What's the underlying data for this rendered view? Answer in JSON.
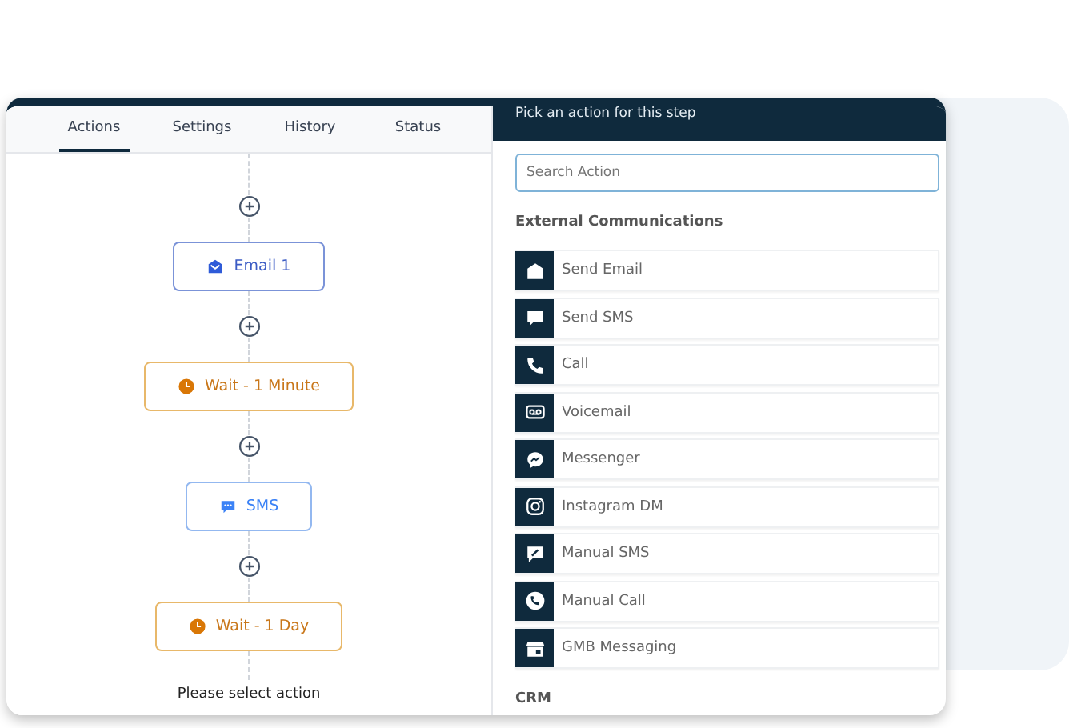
{
  "tabs": [
    {
      "label": "Actions",
      "selected": true
    },
    {
      "label": "Settings",
      "selected": false
    },
    {
      "label": "History",
      "selected": false
    },
    {
      "label": "Status",
      "selected": false
    }
  ],
  "flow": {
    "nodes": [
      {
        "kind": "email",
        "label": "Email 1"
      },
      {
        "kind": "wait",
        "label": "Wait - 1 Minute"
      },
      {
        "kind": "sms",
        "label": "SMS"
      },
      {
        "kind": "wait",
        "label": "Wait - 1 Day"
      }
    ],
    "footer": "Please select action"
  },
  "action_panel": {
    "title": "Pick an action for this step",
    "search": {
      "placeholder": "Search Action"
    },
    "sections": [
      {
        "heading": "External Communications",
        "items": [
          {
            "kind": "email",
            "label": "Send Email"
          },
          {
            "kind": "sms",
            "label": "Send SMS"
          },
          {
            "kind": "call",
            "label": "Call"
          },
          {
            "kind": "voicemail",
            "label": "Voicemail"
          },
          {
            "kind": "messenger",
            "label": "Messenger"
          },
          {
            "kind": "instagram",
            "label": "Instagram DM"
          },
          {
            "kind": "manual_sms",
            "label": "Manual SMS"
          },
          {
            "kind": "manual_call",
            "label": "Manual Call"
          },
          {
            "kind": "gmb",
            "label": "GMB Messaging"
          }
        ]
      },
      {
        "heading": "CRM"
      }
    ]
  }
}
